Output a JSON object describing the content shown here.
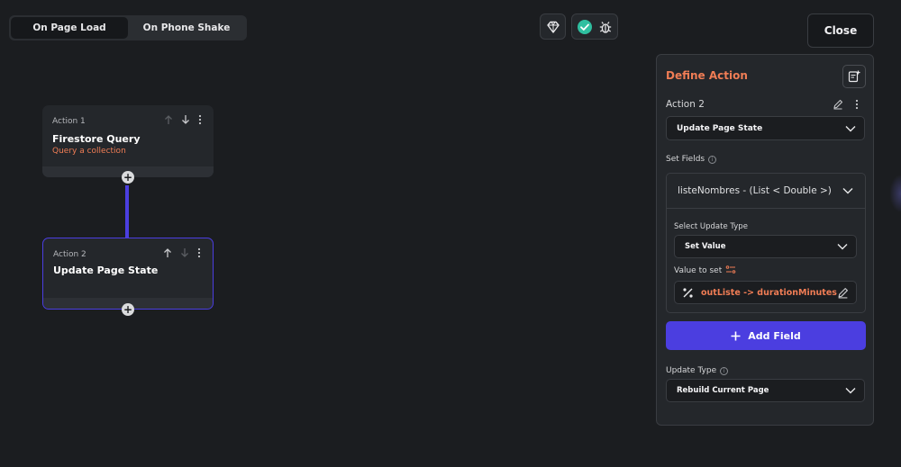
{
  "tabs": [
    {
      "label": "On Page Load",
      "active": true
    },
    {
      "label": "On Phone Shake",
      "active": false
    }
  ],
  "toolbar": {
    "close_label": "Close"
  },
  "actions": [
    {
      "index_label": "Action 1",
      "title": "Firestore Query",
      "subtitle": "Query a collection"
    },
    {
      "index_label": "Action 2",
      "title": "Update Page State",
      "subtitle": ""
    }
  ],
  "panel": {
    "title": "Define Action",
    "action_label": "Action 2",
    "action_type": "Update Page State",
    "set_fields_label": "Set Fields",
    "field_name": "listeNombres - (List < Double >)",
    "select_update_type_label": "Select Update Type",
    "update_type_value": "Set Value",
    "value_to_set_label": "Value to set",
    "value": "outListe -> durationMinutes",
    "add_field_label": "Add Field",
    "update_type_label": "Update Type",
    "rebuild_value": "Rebuild Current Page"
  },
  "colors": {
    "accent": "#4b3ee0",
    "orange": "#f07d55",
    "background": "#1b1d20",
    "panel": "#24272b",
    "success": "#2fbfa0"
  },
  "icons": [
    "diamond-icon",
    "check-circle-icon",
    "bug-icon",
    "arrow-up-icon",
    "arrow-down-icon",
    "more-vert-icon",
    "plus-icon",
    "add-note-icon",
    "edit-icon",
    "chevron-down-icon",
    "info-icon",
    "variable-icon",
    "percent-icon"
  ]
}
